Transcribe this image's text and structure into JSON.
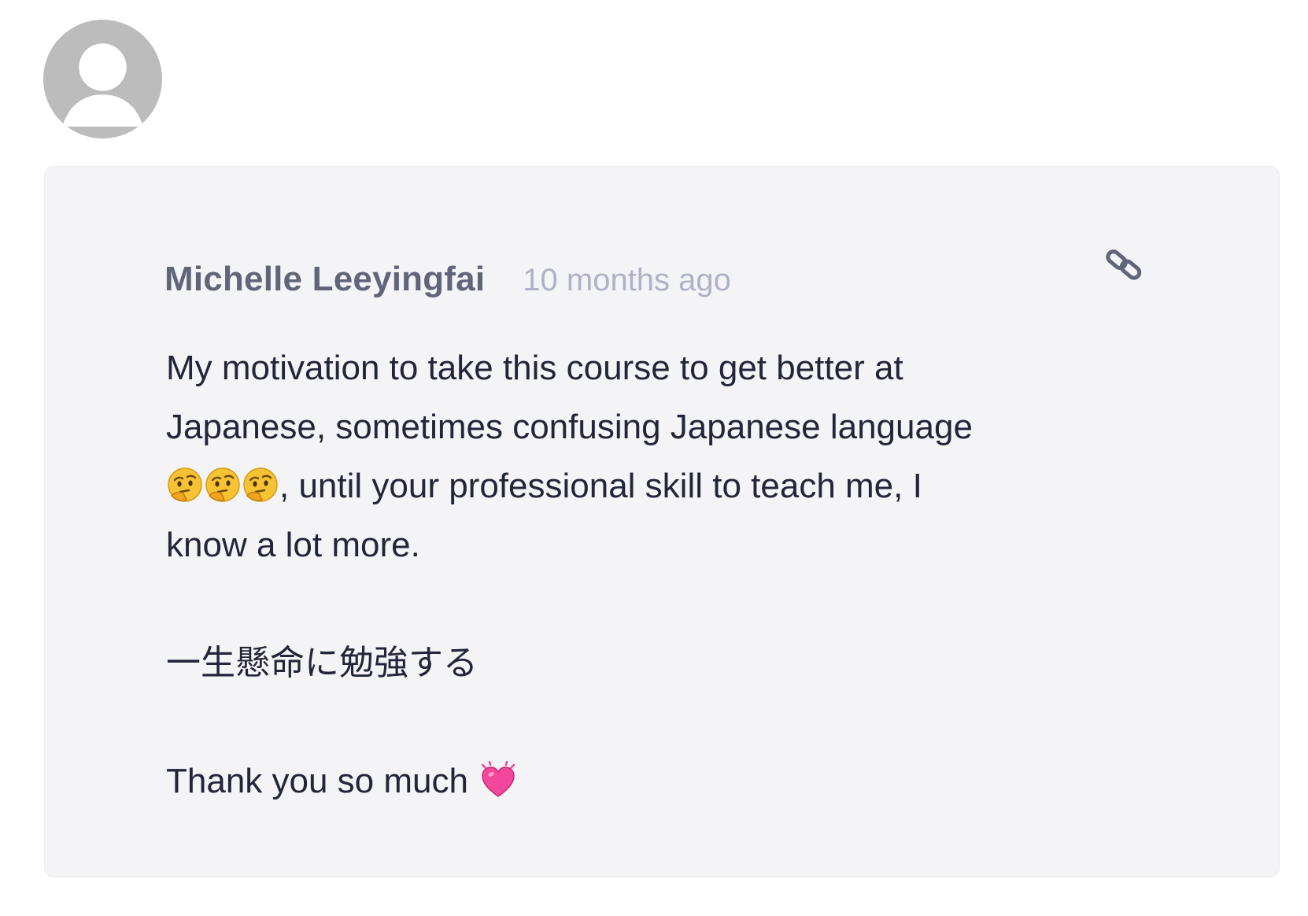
{
  "comment": {
    "author": "Michelle Leeyingfai",
    "timestamp": "10 months ago",
    "body": {
      "line1": "My motivation to take this course to get better at",
      "line2": "Japanese, sometimes confusing Japanese language",
      "line3_text": ", until your professional skill to teach me, I",
      "line4": "know a lot more.",
      "japanese_line": "一生懸命に勉強する",
      "closing": "Thank you so much"
    }
  },
  "icons": {
    "avatar": "default-user-avatar",
    "permalink": "link-icon",
    "thinking_emoji": "thinking-face-emoji",
    "heart_emoji": "beating-heart-emoji"
  },
  "colors": {
    "card_background": "#f4f4f7",
    "author": "#61657a",
    "timestamp": "#aeb2c8",
    "body_text": "#23263a",
    "avatar": "#bcbcbc"
  }
}
